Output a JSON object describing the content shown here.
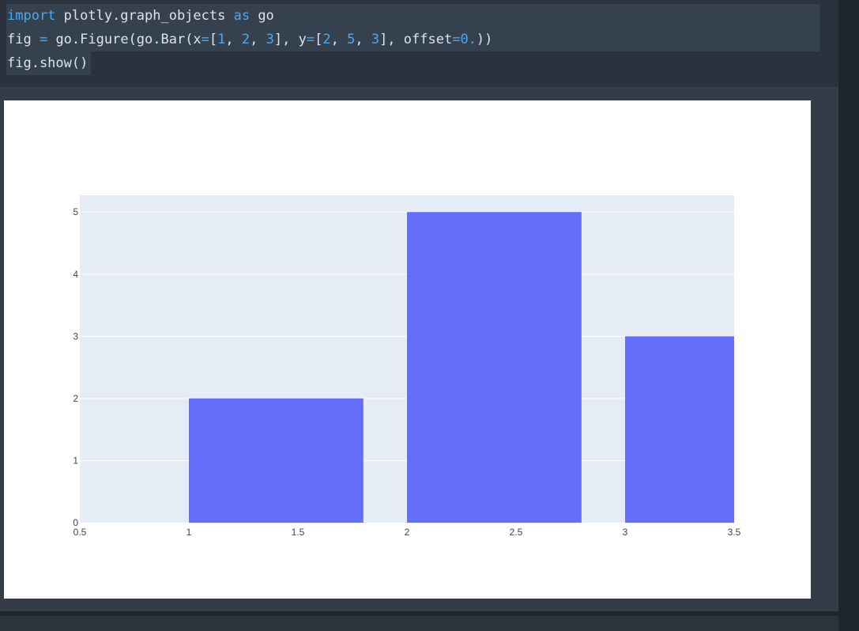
{
  "code": {
    "line1": {
      "kw1": "import",
      "mod": " plotly.graph_objects ",
      "kw2": "as",
      "alias": " go"
    },
    "line2": {
      "p1": "fig ",
      "eq": "=",
      "p2": " go.Figure(go.Bar(x",
      "eq2": "=",
      "p3": "[",
      "n1": "1",
      "c1": ", ",
      "n2": "2",
      "c2": ", ",
      "n3": "3",
      "p4": "], y",
      "eq3": "=",
      "p5": "[",
      "n4": "2",
      "c3": ", ",
      "n5": "5",
      "c4": ", ",
      "n6": "3",
      "p6": "], offset",
      "eq4": "=",
      "n7": "0.",
      "p7": "))"
    },
    "line3": "fig.show()"
  },
  "colors": {
    "bar": "#636efa",
    "plot_bg": "#e5ecf6",
    "grid": "#ffffff",
    "tick_text": "#444444"
  },
  "chart_data": {
    "type": "bar",
    "x": [
      1,
      2,
      3
    ],
    "values": [
      2,
      5,
      3
    ],
    "bar_width": 0.8,
    "offset": 0,
    "xlim": [
      0.5,
      3.5
    ],
    "ylim": [
      0,
      5.27
    ],
    "x_ticks": [
      0.5,
      1,
      1.5,
      2,
      2.5,
      3,
      3.5
    ],
    "x_tick_labels": [
      "0.5",
      "1",
      "1.5",
      "2",
      "2.5",
      "3",
      "3.5"
    ],
    "y_ticks": [
      0,
      1,
      2,
      3,
      4,
      5
    ],
    "y_tick_labels": [
      "0",
      "1",
      "2",
      "3",
      "4",
      "5"
    ],
    "grid": true,
    "title": "",
    "xlabel": "",
    "ylabel": ""
  }
}
